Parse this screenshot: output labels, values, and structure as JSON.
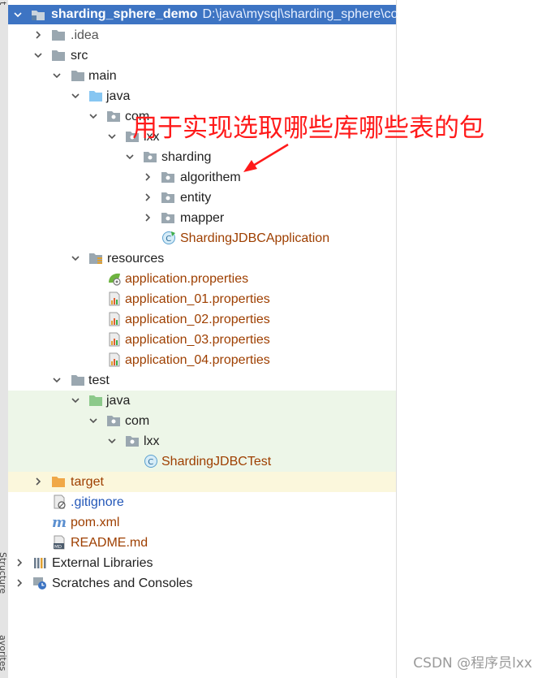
{
  "window": {
    "side_labels": [
      "t",
      "Structure",
      "avorites"
    ]
  },
  "project": {
    "name": "sharding_sphere_demo",
    "path": "D:\\java\\mysql\\sharding_sphere\\co"
  },
  "tree": {
    "idea": ".idea",
    "src": "src",
    "main": "main",
    "java_main": "java",
    "com": "com",
    "lxx": "lxx",
    "sharding": "sharding",
    "algorithem": "algorithem",
    "entity": "entity",
    "mapper": "mapper",
    "app_class": "ShardingJDBCApplication",
    "resources": "resources",
    "props": [
      "application.properties",
      "application_01.properties",
      "application_02.properties",
      "application_03.properties",
      "application_04.properties"
    ],
    "test": "test",
    "java_test": "java",
    "com_test": "com",
    "lxx_test": "lxx",
    "test_class": "ShardingJDBCTest",
    "target": "target",
    "gitignore": ".gitignore",
    "pom": "pom.xml",
    "readme": "README.md",
    "external_libraries": "External Libraries",
    "scratches": "Scratches and Consoles"
  },
  "annotation": {
    "text": "用于实现选取哪些库哪些表的包",
    "color": "#ff1a1a"
  },
  "watermark": "CSDN @程序员lxx",
  "colors": {
    "selection": "#3d74c3",
    "test_bg": "#edf6e8",
    "target_bg": "#fbf7dc",
    "file_orange": "#9e3f00",
    "folder_gray": "#9aa7b0",
    "folder_blue": "#87c6f2",
    "folder_green": "#8cc98a",
    "folder_orange": "#f0a848"
  }
}
